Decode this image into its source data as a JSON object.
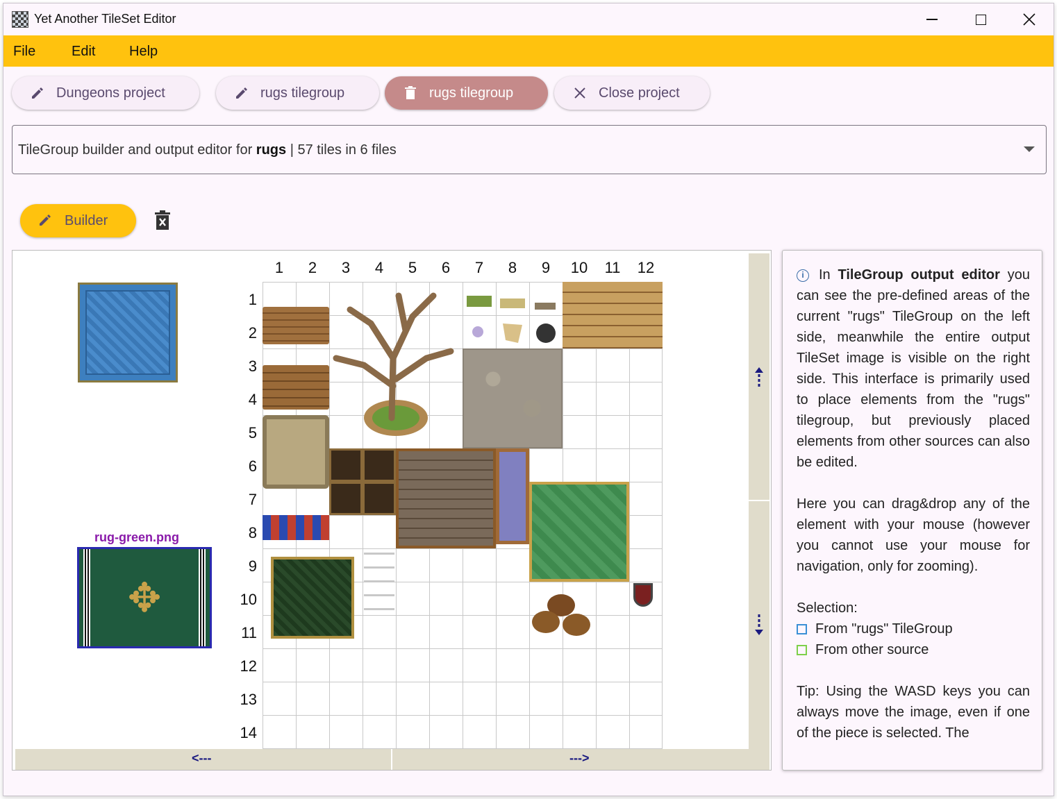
{
  "app": {
    "title": "Yet Another TileSet Editor"
  },
  "menu": {
    "file": "File",
    "edit": "Edit",
    "help": "Help"
  },
  "chips": [
    {
      "label": "Dungeons project",
      "icon": "pencil-icon"
    },
    {
      "label": "rugs tilegroup",
      "icon": "pencil-icon"
    },
    {
      "label": "rugs tilegroup",
      "icon": "trash-icon"
    },
    {
      "label": "Close project",
      "icon": "close-icon"
    }
  ],
  "dropdown": {
    "prefix": "TileGroup builder and output editor for ",
    "name": "rugs",
    "suffix": " | 57 tiles in 6 files"
  },
  "builder": {
    "label": "Builder"
  },
  "canvas": {
    "selected_file": "rug-green.png",
    "columns": [
      "1",
      "2",
      "3",
      "4",
      "5",
      "6",
      "7",
      "8",
      "9",
      "10",
      "11",
      "12"
    ],
    "rows": [
      "1",
      "2",
      "3",
      "4",
      "5",
      "6",
      "7",
      "8",
      "9",
      "10",
      "11",
      "12",
      "13",
      "14"
    ],
    "scroll_left": "<---",
    "scroll_right": "--->"
  },
  "info": {
    "intro_pre": "In ",
    "intro_bold": "TileGroup output editor",
    "intro_post": " you can see the pre-defined areas of the current \"rugs\" TileGroup on the left side, meanwhile the entire output TileSet image is visible on the right side. This interface is primarily used to place elements from the \"rugs\" tilegroup, but previously placed elements from other sources can also be edited.",
    "drag": "Here you can drag&drop any of the element with your mouse (however you cannot use your mouse for navigation, only for zooming).",
    "selection_title": "Selection:",
    "legend_group": "From \"rugs\" TileGroup",
    "legend_other": "From other source",
    "tip": "Tip: Using the WASD keys you can always move the image, even if one of the piece is selected. The",
    "colors": {
      "group": "#3a8fd6",
      "other": "#7ed04a"
    }
  }
}
